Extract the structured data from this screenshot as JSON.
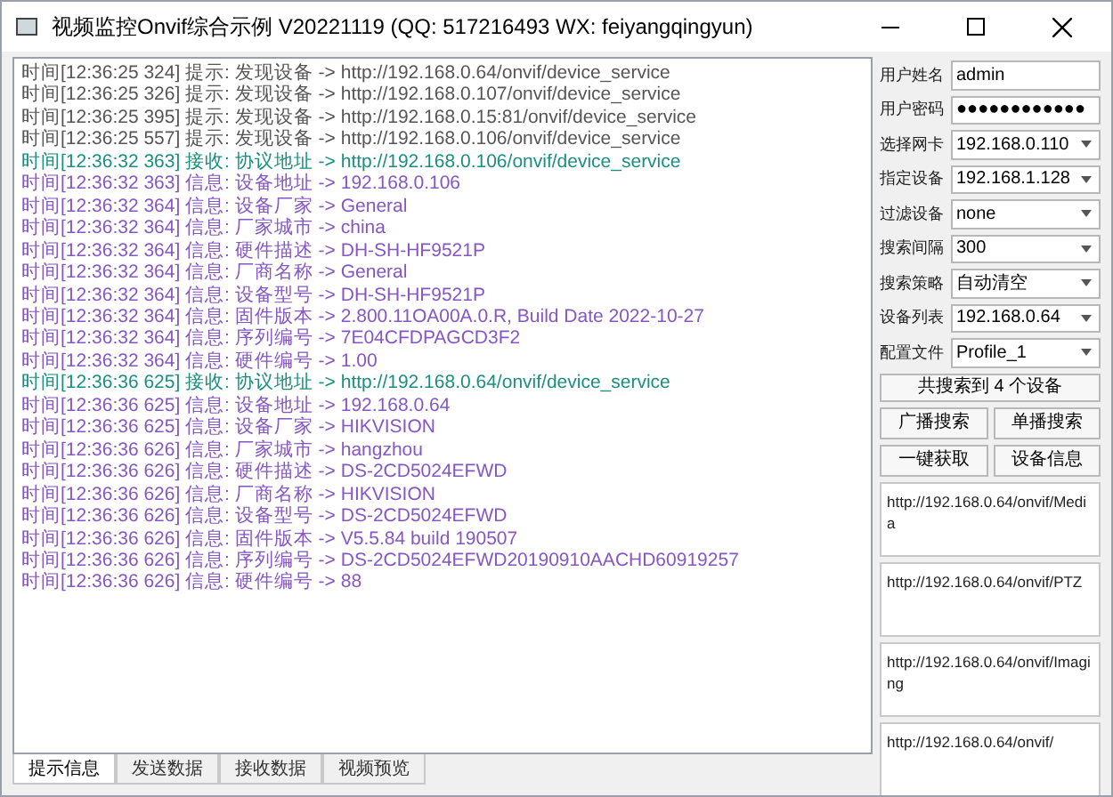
{
  "window": {
    "title": "视频监控Onvif综合示例 V20221119 (QQ: 517216493 WX: feiyangqingyun)"
  },
  "log": [
    {
      "kind": "hint",
      "text": "时间[12:36:25 324] 提示: 发现设备 -> http://192.168.0.64/onvif/device_service"
    },
    {
      "kind": "hint",
      "text": "时间[12:36:25 326] 提示: 发现设备 -> http://192.168.0.107/onvif/device_service"
    },
    {
      "kind": "hint",
      "text": "时间[12:36:25 395] 提示: 发现设备 -> http://192.168.0.15:81/onvif/device_service"
    },
    {
      "kind": "hint",
      "text": "时间[12:36:25 557] 提示: 发现设备 -> http://192.168.0.106/onvif/device_service"
    },
    {
      "kind": "recv",
      "text": "时间[12:36:32 363] 接收: 协议地址 -> http://192.168.0.106/onvif/device_service"
    },
    {
      "kind": "info",
      "text": "时间[12:36:32 363] 信息: 设备地址 -> 192.168.0.106"
    },
    {
      "kind": "info",
      "text": "时间[12:36:32 364] 信息: 设备厂家 -> General"
    },
    {
      "kind": "info",
      "text": "时间[12:36:32 364] 信息: 厂家城市 -> china"
    },
    {
      "kind": "info",
      "text": "时间[12:36:32 364] 信息: 硬件描述 -> DH-SH-HF9521P"
    },
    {
      "kind": "info",
      "text": "时间[12:36:32 364] 信息: 厂商名称 -> General"
    },
    {
      "kind": "info",
      "text": "时间[12:36:32 364] 信息: 设备型号 -> DH-SH-HF9521P"
    },
    {
      "kind": "info",
      "text": "时间[12:36:32 364] 信息: 固件版本 -> 2.800.11OA00A.0.R, Build Date 2022-10-27"
    },
    {
      "kind": "info",
      "text": "时间[12:36:32 364] 信息: 序列编号 -> 7E04CFDPAGCD3F2"
    },
    {
      "kind": "info",
      "text": "时间[12:36:32 364] 信息: 硬件编号 -> 1.00"
    },
    {
      "kind": "recv",
      "text": "时间[12:36:36 625] 接收: 协议地址 -> http://192.168.0.64/onvif/device_service"
    },
    {
      "kind": "info",
      "text": "时间[12:36:36 625] 信息: 设备地址 -> 192.168.0.64"
    },
    {
      "kind": "info",
      "text": "时间[12:36:36 625] 信息: 设备厂家 -> HIKVISION"
    },
    {
      "kind": "info",
      "text": "时间[12:36:36 626] 信息: 厂家城市 -> hangzhou"
    },
    {
      "kind": "info",
      "text": "时间[12:36:36 626] 信息: 硬件描述 -> DS-2CD5024EFWD"
    },
    {
      "kind": "info",
      "text": "时间[12:36:36 626] 信息: 厂商名称 -> HIKVISION"
    },
    {
      "kind": "info",
      "text": "时间[12:36:36 626] 信息: 设备型号 -> DS-2CD5024EFWD"
    },
    {
      "kind": "info",
      "text": "时间[12:36:36 626] 信息: 固件版本 -> V5.5.84 build 190507"
    },
    {
      "kind": "info",
      "text": "时间[12:36:36 626] 信息: 序列编号 -> DS-2CD5024EFWD20190910AACHD60919257"
    },
    {
      "kind": "info",
      "text": "时间[12:36:36 626] 信息: 硬件编号 -> 88"
    }
  ],
  "tabs": [
    {
      "label": "提示信息",
      "selected": true
    },
    {
      "label": "发送数据",
      "selected": false
    },
    {
      "label": "接收数据",
      "selected": false
    },
    {
      "label": "视频预览",
      "selected": false
    }
  ],
  "form": [
    {
      "kind": "input",
      "label": "用户姓名",
      "value": "admin"
    },
    {
      "kind": "input",
      "label": "用户密码",
      "value": "●●●●●●●●●●●●"
    },
    {
      "kind": "select",
      "label": "选择网卡",
      "value": "192.168.0.110"
    },
    {
      "kind": "select",
      "label": "指定设备",
      "value": "192.168.1.128"
    },
    {
      "kind": "select",
      "label": "过滤设备",
      "value": "none"
    },
    {
      "kind": "select",
      "label": "搜索间隔",
      "value": "300"
    },
    {
      "kind": "select",
      "label": "搜索策略",
      "value": "自动清空"
    },
    {
      "kind": "select",
      "label": "设备列表",
      "value": "192.168.0.64"
    },
    {
      "kind": "select",
      "label": "配置文件",
      "value": "Profile_1"
    }
  ],
  "found_label": "共搜索到 4 个设备",
  "buttons": [
    "广播搜索",
    "单播搜索",
    "一键获取",
    "设备信息"
  ],
  "addresses": [
    "http://192.168.0.64/onvif/Media",
    "http://192.168.0.64/onvif/PTZ",
    "http://192.168.0.64/onvif/Imaging",
    "http://192.168.0.64/onvif/"
  ]
}
